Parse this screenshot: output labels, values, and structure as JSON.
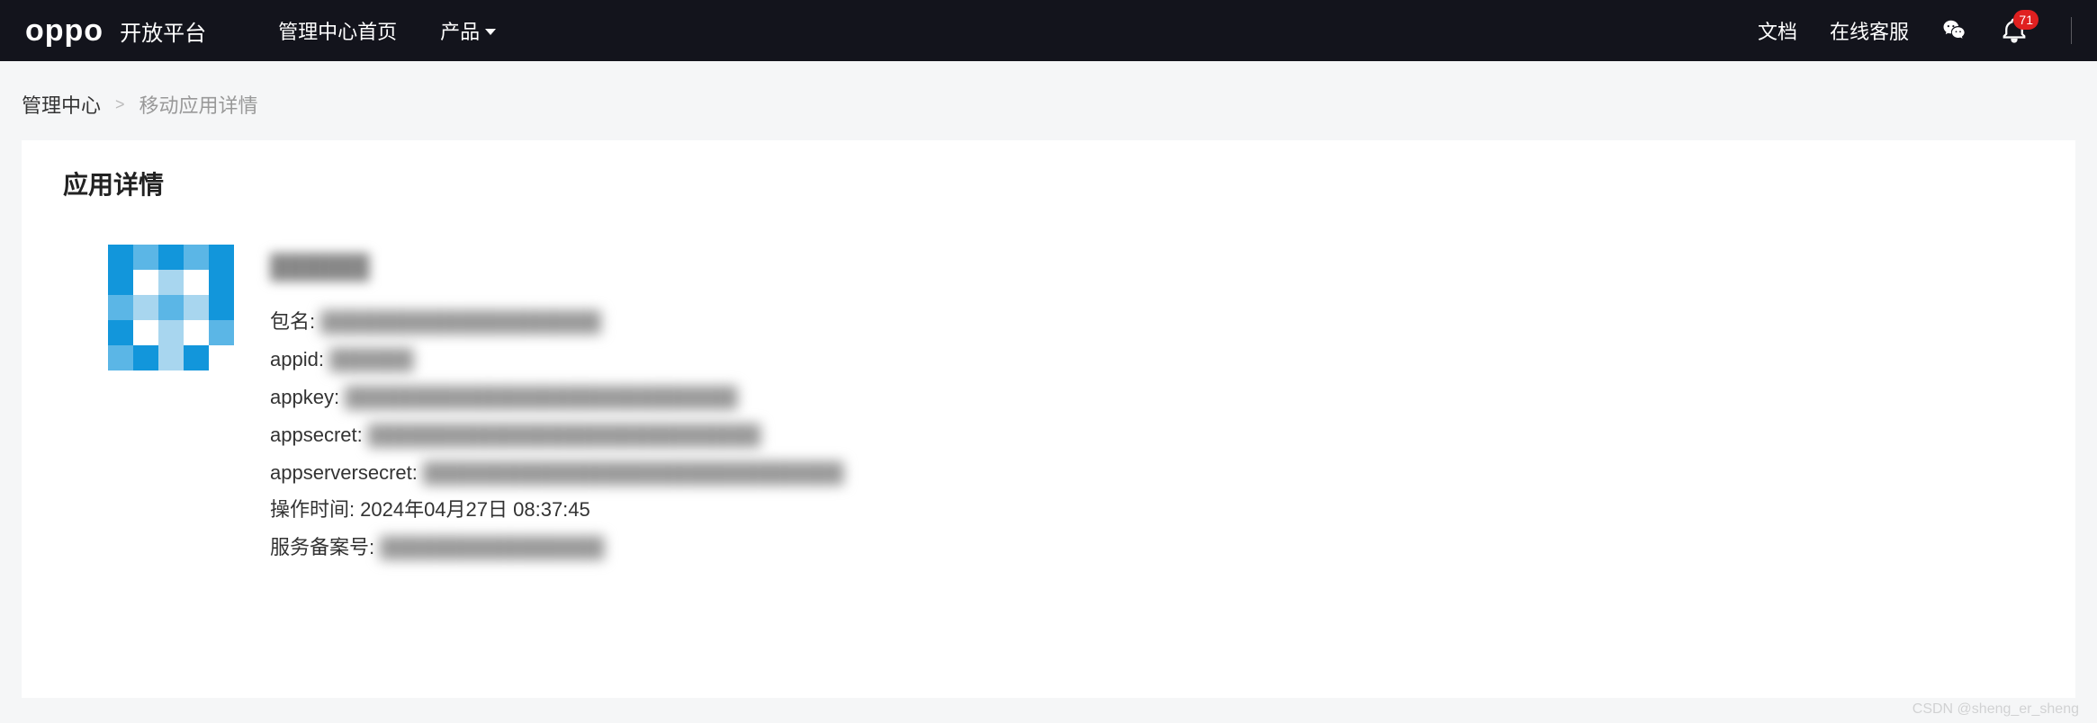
{
  "header": {
    "logo": "oppo",
    "platform": "开放平台",
    "nav_home": "管理中心首页",
    "nav_product": "产品",
    "nav_docs": "文档",
    "nav_support": "在线客服",
    "badge_count": "71"
  },
  "breadcrumb": {
    "root": "管理中心",
    "current": "移动应用详情"
  },
  "content": {
    "title": "应用详情",
    "app_name": "██████",
    "fields": {
      "package_label": "包名:",
      "package_value": "████████████████████",
      "appid_label": "appid:",
      "appid_value": "██████",
      "appkey_label": "appkey:",
      "appkey_value": "████████████████████████████",
      "appsecret_label": "appsecret:",
      "appsecret_value": "████████████████████████████",
      "appserversecret_label": "appserversecret:",
      "appserversecret_value": "██████████████████████████████",
      "optime_label": "操作时间:",
      "optime_value": "2024年04月27日 08:37:45",
      "filing_label": "服务备案号:",
      "filing_value": "████████████████"
    }
  },
  "watermark": "CSDN @sheng_er_sheng"
}
